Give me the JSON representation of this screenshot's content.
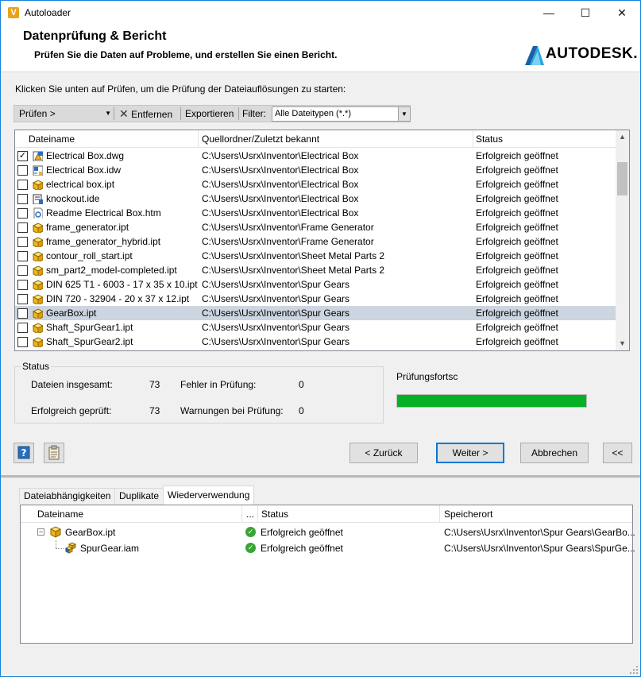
{
  "window": {
    "app_icon_letter": "V",
    "title": "Autoloader",
    "minimize": "—",
    "maximize": "☐",
    "close": "✕"
  },
  "header": {
    "title": "Datenprüfung & Bericht",
    "subtitle": "Prüfen Sie die Daten auf Probleme, und erstellen Sie einen Bericht.",
    "logo_text": "AUTODESK."
  },
  "instruction": "Klicken Sie unten auf Prüfen, um die Prüfung der Dateiauflösungen zu starten:",
  "toolbar": {
    "check_label": "Prüfen >",
    "remove_label": "Entfernen",
    "export_label": "Exportieren",
    "filter_label": "Filter:",
    "filter_value": "Alle Dateitypen (*.*)"
  },
  "file_list": {
    "columns": [
      "Dateiname",
      "Quellordner/Zuletzt bekannt",
      "Status"
    ],
    "rows": [
      {
        "name": "Electrical Box.dwg",
        "path": "C:\\Users\\Usrx\\Inventor\\Electrical Box",
        "status": "Erfolgreich geöffnet",
        "checked": true,
        "icon": "dwg-icon"
      },
      {
        "name": "Electrical Box.idw",
        "path": "C:\\Users\\Usrx\\Inventor\\Electrical Box",
        "status": "Erfolgreich geöffnet",
        "checked": false,
        "icon": "idw-icon"
      },
      {
        "name": "electrical box.ipt",
        "path": "C:\\Users\\Usrx\\Inventor\\Electrical Box",
        "status": "Erfolgreich geöffnet",
        "checked": false,
        "icon": "part-icon"
      },
      {
        "name": "knockout.ide",
        "path": "C:\\Users\\Usrx\\Inventor\\Electrical Box",
        "status": "Erfolgreich geöffnet",
        "checked": false,
        "icon": "ide-icon"
      },
      {
        "name": "Readme Electrical Box.htm",
        "path": "C:\\Users\\Usrx\\Inventor\\Electrical Box",
        "status": "Erfolgreich geöffnet",
        "checked": false,
        "icon": "htm-icon"
      },
      {
        "name": "frame_generator.ipt",
        "path": "C:\\Users\\Usrx\\Inventor\\Frame Generator",
        "status": "Erfolgreich geöffnet",
        "checked": false,
        "icon": "part-icon"
      },
      {
        "name": "frame_generator_hybrid.ipt",
        "path": "C:\\Users\\Usrx\\Inventor\\Frame Generator",
        "status": "Erfolgreich geöffnet",
        "checked": false,
        "icon": "part-icon"
      },
      {
        "name": "contour_roll_start.ipt",
        "path": "C:\\Users\\Usrx\\Inventor\\Sheet Metal Parts 2",
        "status": "Erfolgreich geöffnet",
        "checked": false,
        "icon": "part-icon"
      },
      {
        "name": "sm_part2_model-completed.ipt",
        "path": "C:\\Users\\Usrx\\Inventor\\Sheet Metal Parts 2",
        "status": "Erfolgreich geöffnet",
        "checked": false,
        "icon": "part-icon"
      },
      {
        "name": "DIN 625 T1 - 6003 - 17 x 35 x 10.ipt",
        "path": "C:\\Users\\Usrx\\Inventor\\Spur Gears",
        "status": "Erfolgreich geöffnet",
        "checked": false,
        "icon": "part-icon"
      },
      {
        "name": "DIN 720 - 32904 - 20 x 37 x 12.ipt",
        "path": "C:\\Users\\Usrx\\Inventor\\Spur Gears",
        "status": "Erfolgreich geöffnet",
        "checked": false,
        "icon": "part-icon"
      },
      {
        "name": "GearBox.ipt",
        "path": "C:\\Users\\Usrx\\Inventor\\Spur Gears",
        "status": "Erfolgreich geöffnet",
        "checked": false,
        "icon": "part-icon",
        "selected": true
      },
      {
        "name": "Shaft_SpurGear1.ipt",
        "path": "C:\\Users\\Usrx\\Inventor\\Spur Gears",
        "status": "Erfolgreich geöffnet",
        "checked": false,
        "icon": "part-icon"
      },
      {
        "name": "Shaft_SpurGear2.ipt",
        "path": "C:\\Users\\Usrx\\Inventor\\Spur Gears",
        "status": "Erfolgreich geöffnet",
        "checked": false,
        "icon": "part-icon"
      }
    ]
  },
  "status": {
    "legend": "Status",
    "total_label": "Dateien insgesamt:",
    "total_value": "73",
    "checked_label": "Erfolgreich geprüft:",
    "checked_value": "73",
    "errors_label": "Fehler in Prüfung:",
    "errors_value": "0",
    "warnings_label": "Warnungen bei Prüfung:",
    "warnings_value": "0"
  },
  "progress": {
    "label": "Prüfungsfortsc",
    "fraction": 1.0,
    "color": "#06b025"
  },
  "buttons": {
    "back": "< Zurück",
    "next": "Weiter >",
    "cancel": "Abbrechen",
    "collapse": "<<"
  },
  "tabs": [
    "Dateiabhängigkeiten",
    "Duplikate",
    "Wiederverwendung"
  ],
  "reuse": {
    "columns": [
      "Dateiname",
      "...",
      "Status",
      "Speicherort"
    ],
    "rows": [
      {
        "name": "GearBox.ipt",
        "status": "Erfolgreich geöffnet",
        "location": "C:\\Users\\Usrx\\Inventor\\Spur Gears\\GearBo..."
      },
      {
        "name": "SpurGear.iam",
        "status": "Erfolgreich geöffnet",
        "location": "C:\\Users\\Usrx\\Inventor\\Spur Gears\\SpurGe..."
      }
    ]
  }
}
